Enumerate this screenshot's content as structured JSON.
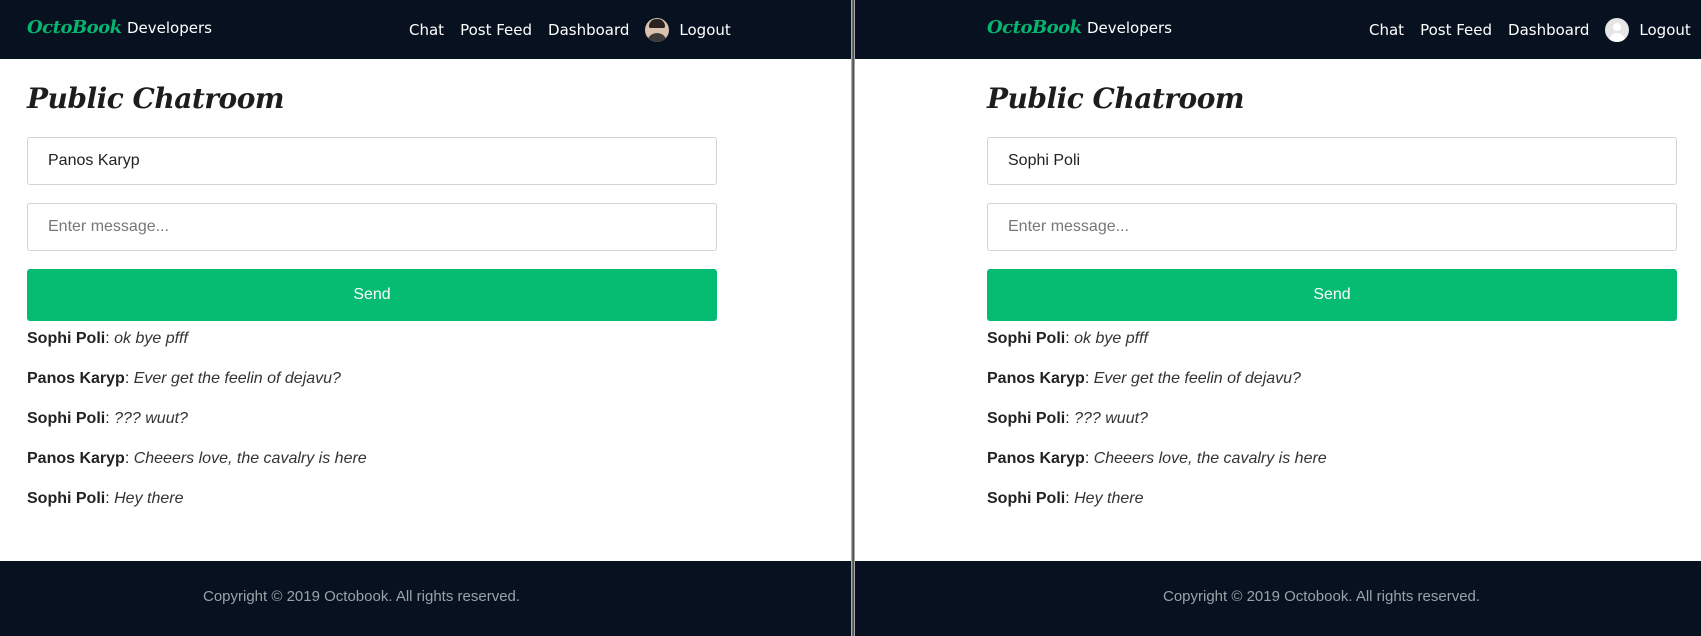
{
  "windows": [
    {
      "nav": {
        "brand": "OctoBook",
        "developers": "Developers",
        "links": [
          "Chat",
          "Post Feed",
          "Dashboard"
        ],
        "avatar_icon": "user-photo-avatar",
        "logout": "Logout"
      },
      "title": "Public Chatroom",
      "name_value": "Panos Karyp",
      "message_placeholder": "Enter message...",
      "send_label": "Send",
      "messages": [
        {
          "author": "Sophi Poli",
          "text": "ok bye pfff"
        },
        {
          "author": "Panos Karyp",
          "text": "Ever get the feelin of dejavu?"
        },
        {
          "author": "Sophi Poli",
          "text": "??? wuut?"
        },
        {
          "author": "Panos Karyp",
          "text": "Cheeers love, the cavalry is here"
        },
        {
          "author": "Sophi Poli",
          "text": "Hey there"
        }
      ],
      "footer": "Copyright © 2019 Octobook. All rights reserved."
    },
    {
      "nav": {
        "brand": "OctoBook",
        "developers": "Developers",
        "links": [
          "Chat",
          "Post Feed",
          "Dashboard"
        ],
        "avatar_icon": "default-user-avatar",
        "logout": "Logout"
      },
      "title": "Public Chatroom",
      "name_value": "Sophi Poli",
      "message_placeholder": "Enter message...",
      "send_label": "Send",
      "messages": [
        {
          "author": "Sophi Poli",
          "text": "ok bye pfff"
        },
        {
          "author": "Panos Karyp",
          "text": "Ever get the feelin of dejavu?"
        },
        {
          "author": "Sophi Poli",
          "text": "??? wuut?"
        },
        {
          "author": "Panos Karyp",
          "text": "Cheeers love, the cavalry is here"
        },
        {
          "author": "Sophi Poli",
          "text": "Hey there"
        }
      ],
      "footer": "Copyright © 2019 Octobook. All rights reserved."
    }
  ],
  "colors": {
    "nav_bg": "#07111f",
    "brand": "#06b66e",
    "send_button": "#06bb72",
    "footer_text": "#9aa1a8"
  }
}
